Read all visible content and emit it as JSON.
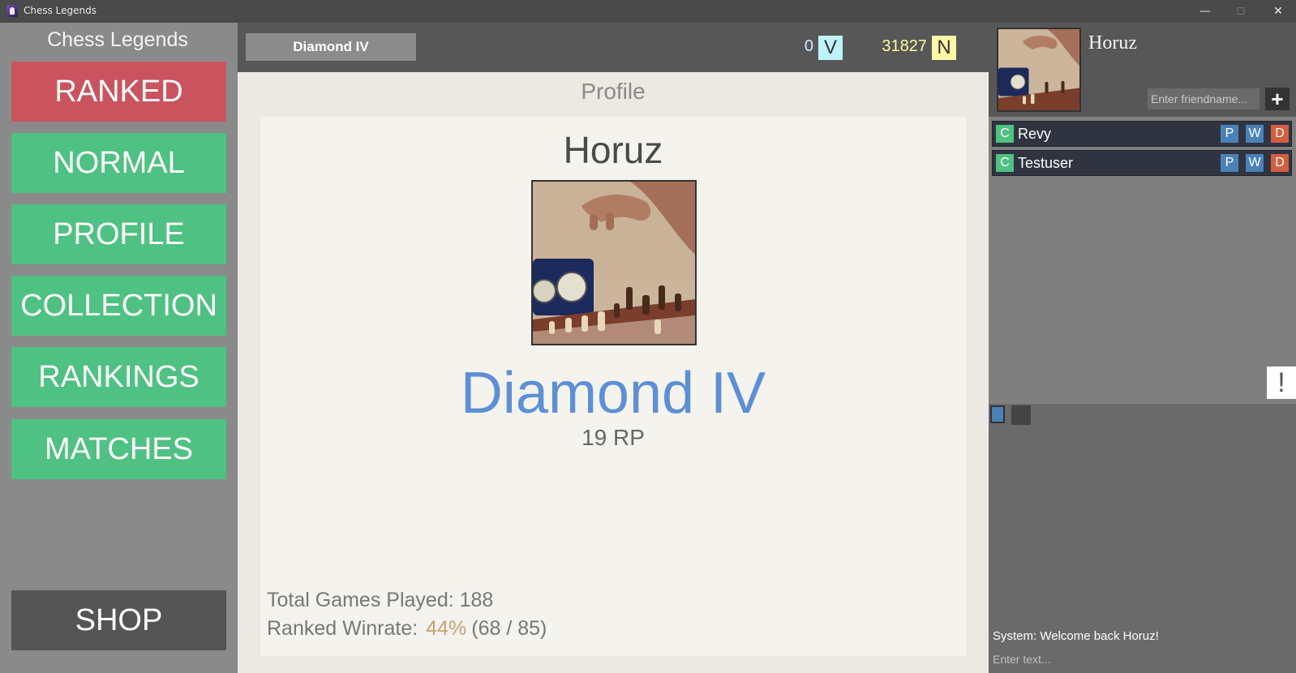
{
  "window": {
    "title": "Chess Legends",
    "controls": {
      "minimize": "—",
      "maximize": "☐",
      "close": "✕"
    }
  },
  "sidebar": {
    "brand": "Chess Legends",
    "buttons": [
      "RANKED",
      "NORMAL",
      "PROFILE",
      "COLLECTION",
      "RANKINGS",
      "MATCHES"
    ],
    "shop": "SHOP"
  },
  "topbar": {
    "rank": "Diamond IV",
    "currency1": {
      "value": "0",
      "badge": "V"
    },
    "currency2": {
      "value": "31827",
      "badge": "N"
    }
  },
  "profile": {
    "page_title": "Profile",
    "name": "Horuz",
    "rank": "Diamond IV",
    "rp": "19 RP",
    "games_label": "Total Games Played: 188",
    "winrate_label": "Ranked Winrate:",
    "winrate_pct": "44%",
    "winrate_frac": "(68 / 85)"
  },
  "right_panel": {
    "name": "Horuz",
    "friend_placeholder": "Enter friendname...",
    "add_label": "+",
    "friends": [
      {
        "status": "C",
        "name": "Revy",
        "actions": [
          "P",
          "W",
          "D"
        ]
      },
      {
        "status": "C",
        "name": "Testuser",
        "actions": [
          "P",
          "W",
          "D"
        ]
      }
    ],
    "alert": "!",
    "chat": {
      "message": "System: Welcome back Horuz!",
      "input_placeholder": "Enter text..."
    }
  },
  "colors": {
    "ranked": "#c9545e",
    "nav_green": "#4fc182",
    "shop": "#555555",
    "rank_blue": "#5d8fd6",
    "winrate_gold": "#c7a277"
  }
}
